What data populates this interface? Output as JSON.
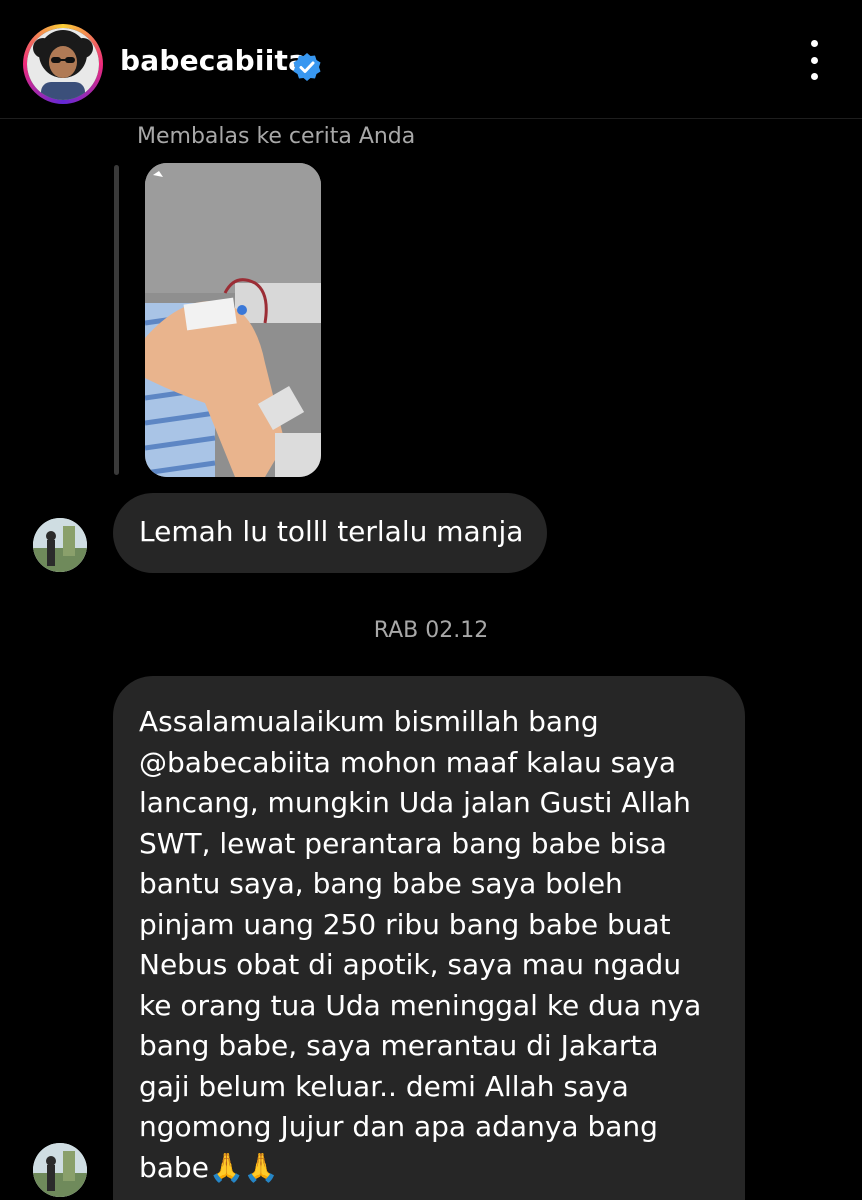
{
  "header": {
    "username": "babecabiita",
    "verified_icon": "verified-badge-icon",
    "more_icon": "more-vertical-icon",
    "colors": {
      "verified": "#3897f0",
      "ring": [
        "#f9ce34",
        "#ee2a7b",
        "#6228d7"
      ]
    }
  },
  "story_reply": {
    "label": "Membalas ke cerita Anda"
  },
  "messages": [
    {
      "text": "Lemah lu tolll terlalu manja"
    }
  ],
  "timestamp": "RAB 02.12",
  "long_message": {
    "lines": [
      "Assalamualaikum bismillah bang",
      "@babecabiita mohon maaf kalau saya",
      "lancang, mungkin Uda jalan Gusti Allah",
      "SWT, lewat perantara bang babe bisa",
      "bantu saya, bang babe saya boleh",
      "pinjam uang 250 ribu bang babe buat",
      "Nebus obat di apotik, saya mau ngadu",
      "ke orang tua Uda meninggal ke dua nya",
      "bang babe, saya merantau di Jakarta",
      "gaji belum keluar.. demi Allah saya",
      "ngomong Jujur dan apa adanya bang",
      "babe"
    ],
    "emoji": "🙏🙏"
  },
  "colors": {
    "background": "#000000",
    "bubble": "#262626",
    "secondary_text": "#a8a8a8"
  }
}
